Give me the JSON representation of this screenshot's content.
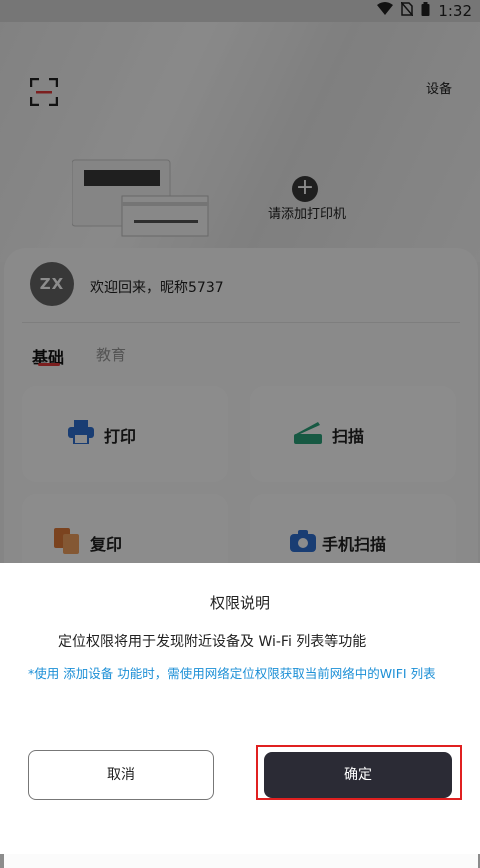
{
  "status_bar": {
    "time": "1:32"
  },
  "header": {
    "device_label": "设备",
    "add_printer_label": "请添加打印机"
  },
  "user": {
    "avatar_text": "ZX",
    "welcome": "欢迎回来，昵称5737"
  },
  "tabs": [
    {
      "label": "基础"
    },
    {
      "label": "教育"
    }
  ],
  "tiles": [
    {
      "label": "打印",
      "icon": "printer-icon"
    },
    {
      "label": "扫描",
      "icon": "scanner-icon"
    },
    {
      "label": "复印",
      "icon": "copy-icon"
    },
    {
      "label": "手机扫描",
      "icon": "camera-icon"
    }
  ],
  "dialog": {
    "title": "权限说明",
    "body": "定位权限将用于发现附近设备及 Wi-Fi 列表等功能",
    "note": "*使用 添加设备 功能时，需使用网络定位权限获取当前网络中的WIFI 列表",
    "cancel_label": "取消",
    "confirm_label": "确定"
  },
  "colors": {
    "accent_red": "#e02020",
    "note_blue": "#1c8fd6",
    "confirm_bg": "#2b2b35"
  }
}
